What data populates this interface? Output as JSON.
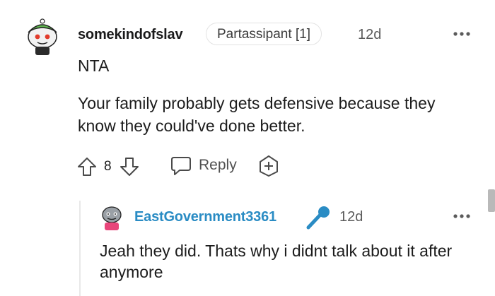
{
  "comment": {
    "username": "somekindofslav",
    "flair": "Partassipant [1]",
    "time": "12d",
    "lines": [
      "NTA",
      "Your family probably gets defensive because they know they could've done better."
    ],
    "votes": "8",
    "reply_label": "Reply",
    "icons": [
      "upvote-icon",
      "downvote-icon",
      "reply-icon",
      "award-icon",
      "more-icon"
    ]
  },
  "reply": {
    "username": "EastGovernment3361",
    "time": "12d",
    "text": "Jeah they did. Thats why i didnt talk about it after anymore",
    "icons": [
      "microphone-icon",
      "more-icon"
    ]
  },
  "colors": {
    "username_reply": "#2a8cc4",
    "mic": "#2a8cc4",
    "muted": "#5b5b5b"
  }
}
